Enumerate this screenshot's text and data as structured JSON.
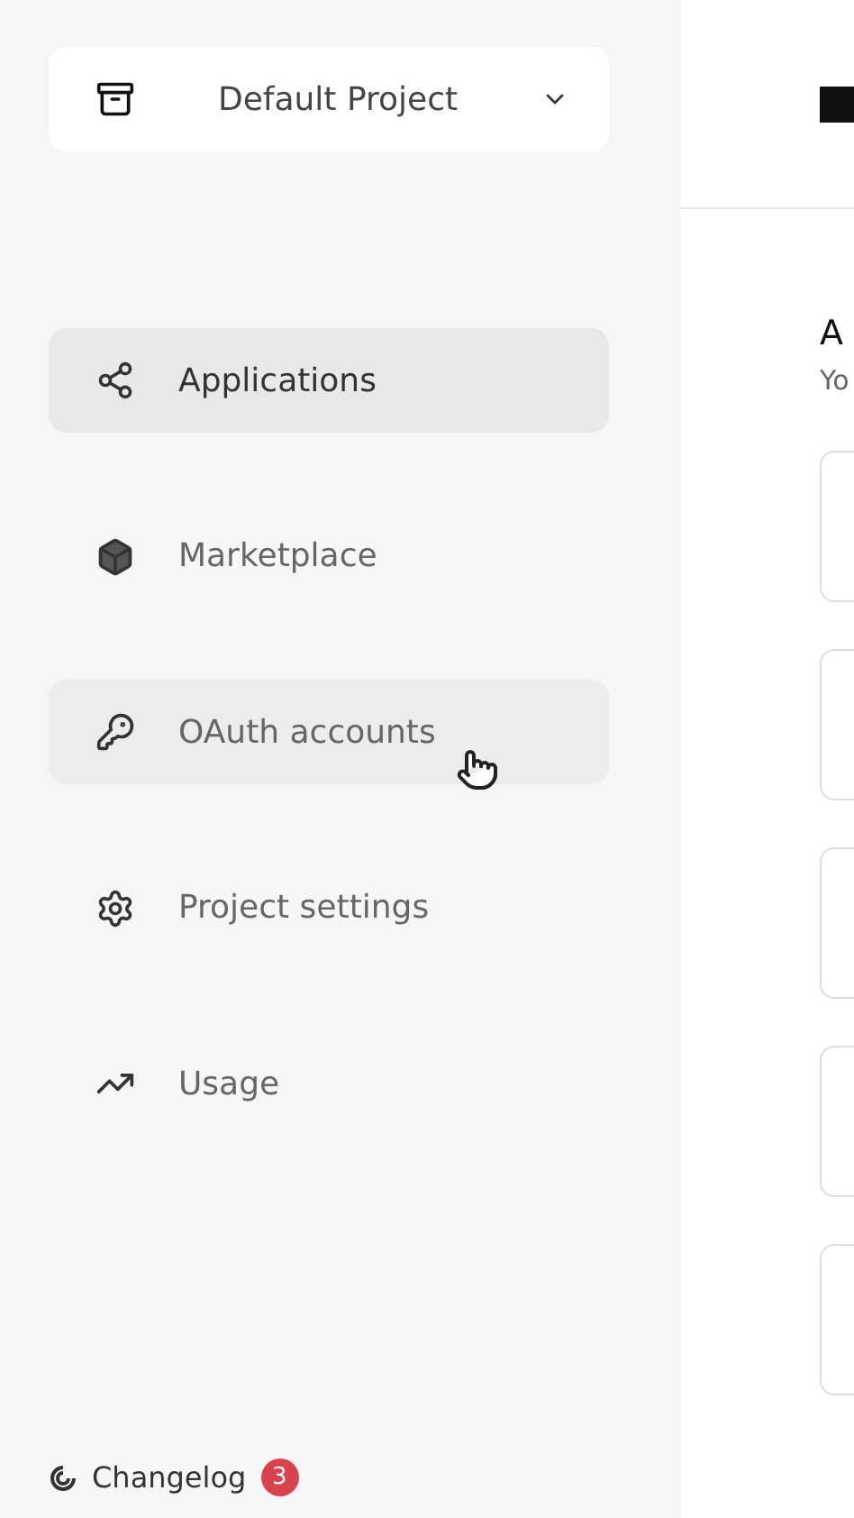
{
  "project_selector": {
    "label": "Default Project"
  },
  "nav": [
    {
      "kind": "share",
      "label": "Applications",
      "selected": true,
      "hovered": false
    },
    {
      "kind": "cube",
      "label": "Marketplace",
      "selected": false,
      "hovered": false
    },
    {
      "kind": "key",
      "label": "OAuth accounts",
      "selected": false,
      "hovered": true
    },
    {
      "kind": "gear",
      "label": "Project settings",
      "selected": false,
      "hovered": false
    },
    {
      "kind": "trend",
      "label": "Usage",
      "selected": false,
      "hovered": false
    }
  ],
  "changelog": {
    "label": "Changelog",
    "badge": "3"
  },
  "main": {
    "heading": "A",
    "subtitle": "Yo",
    "cards": [
      {
        "kind": "empty"
      },
      {
        "kind": "empty"
      },
      {
        "kind": "empty"
      },
      {
        "kind": "empty"
      },
      {
        "kind": "empty"
      }
    ]
  }
}
